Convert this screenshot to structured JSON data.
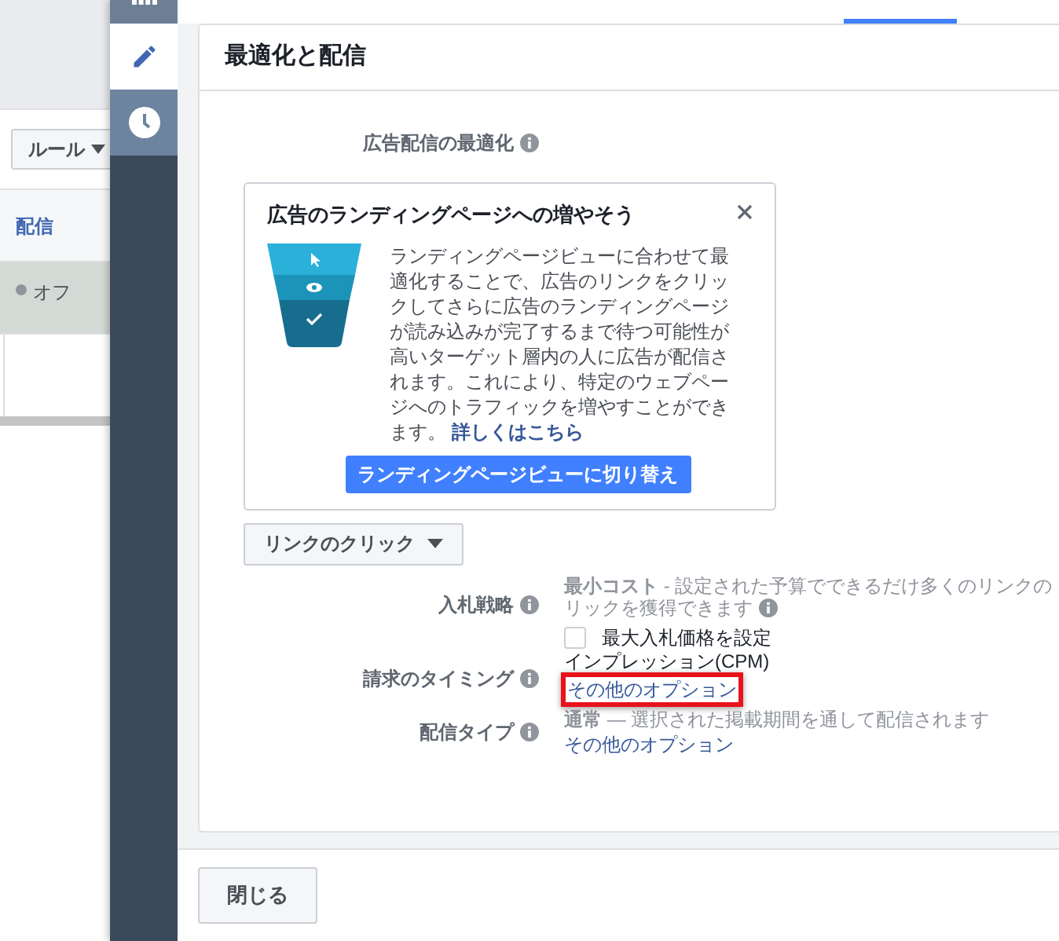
{
  "background_page": {
    "rule_button": "ルール",
    "table_header": "配信",
    "row": {
      "status": "オフ",
      "selected": true
    }
  },
  "nav": [
    {
      "kind": "edit",
      "selected": true
    },
    {
      "kind": "history",
      "selected": false
    }
  ],
  "section_title": "最適化と配信",
  "optimization": {
    "label": "広告配信の最適化",
    "tip": {
      "title": "広告のランディングページへの増やそう",
      "body": "ランディングページビューに合わせて最適化することで、広告のリンクをクリックしてさらに広告のランディングページが読み込みが完了するまで待つ可能性が高いターゲット層内の人に広告が配信されます。これにより、特定のウェブページへのトラフィックを増やすことができます。",
      "link": "詳しくはこちら",
      "button": "ランディングページビューに切り替え"
    },
    "dropdown": "リンクのクリック"
  },
  "bid_strategy": {
    "label": "入札戦略",
    "value": "**最小コスト** - 設定された予算でできるだけ多くのリンクの",
    "value_cont": "リックを獲得できます",
    "checkbox": {
      "label": "最大入札価格を設定",
      "checked": false
    }
  },
  "billing": {
    "label": "請求のタイミング",
    "value": "インプレッション(CPM)",
    "link": "その他のオプション",
    "highlighted": true
  },
  "delivery_type": {
    "label": "配信タイプ",
    "value": "**通常** — 選択された掲載期間を通して配信されます",
    "link": "その他のオプション"
  },
  "close_button": "閉じる"
}
